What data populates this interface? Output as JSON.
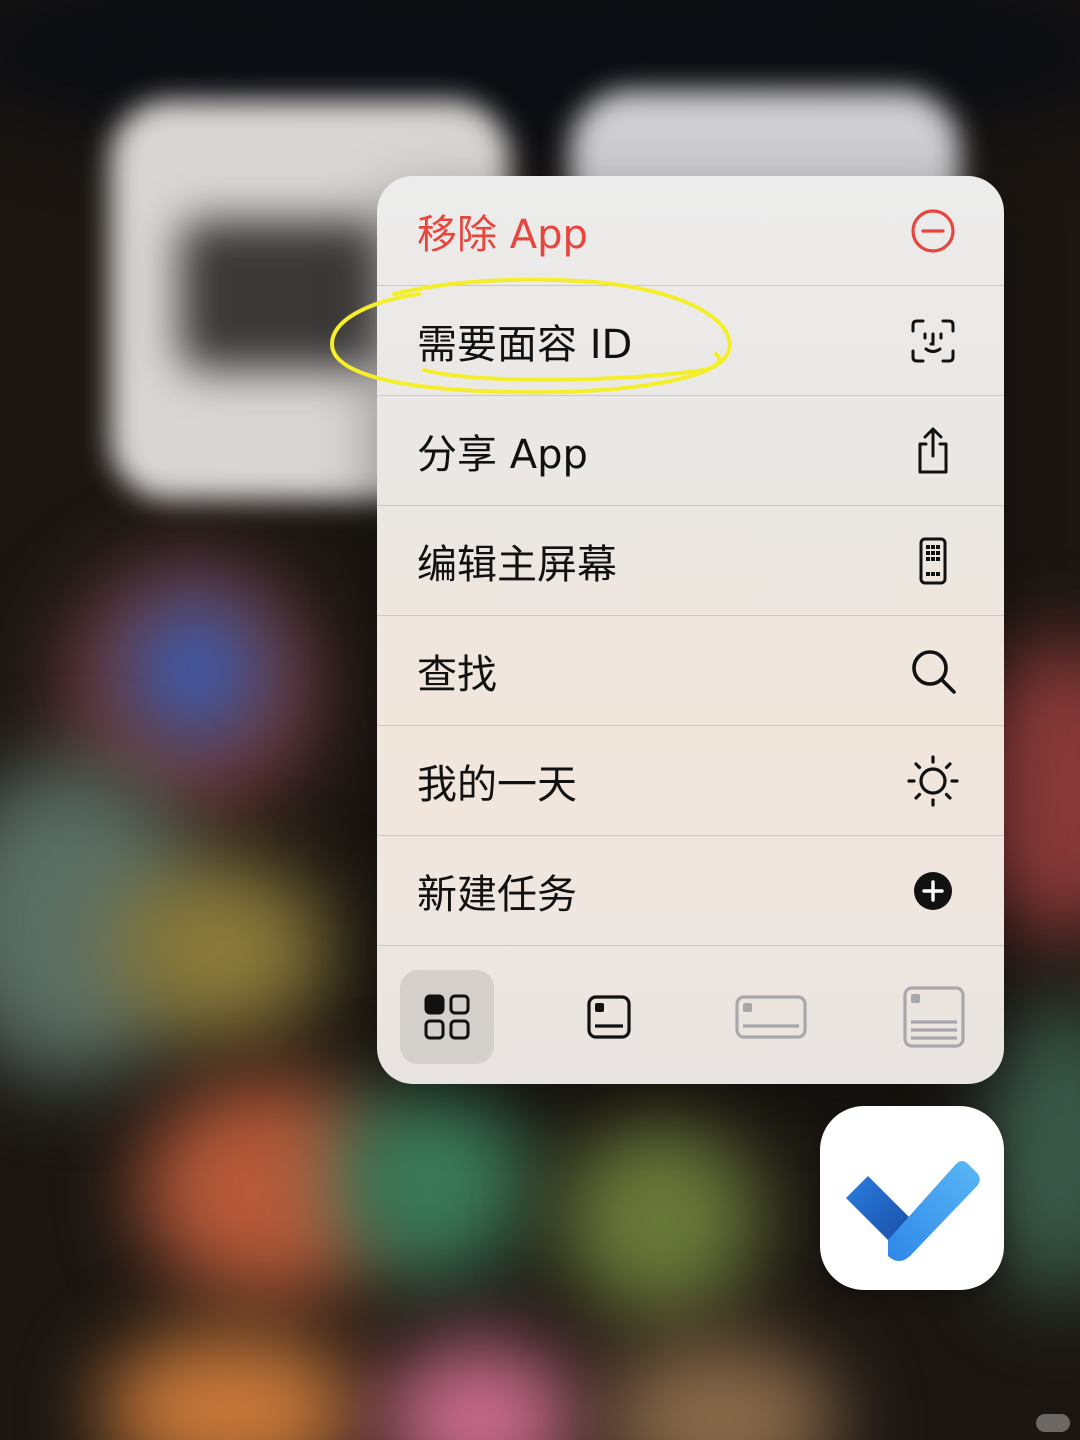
{
  "menu": {
    "items": [
      {
        "label": "移除 App",
        "icon": "minus-circle-icon",
        "destructive": true
      },
      {
        "label": "需要面容 ID",
        "icon": "face-id-icon"
      },
      {
        "label": "分享 App",
        "icon": "share-icon"
      },
      {
        "label": "编辑主屏幕",
        "icon": "phone-grid-icon"
      },
      {
        "label": "查找",
        "icon": "magnifier-icon"
      },
      {
        "label": "我的一天",
        "icon": "sun-icon"
      },
      {
        "label": "新建任务",
        "icon": "plus-circle-filled-icon"
      }
    ],
    "widget_sizes": [
      {
        "icon": "app-grid-icon",
        "selected": true
      },
      {
        "icon": "small-widget-icon",
        "selected": false
      },
      {
        "icon": "medium-widget-icon",
        "selected": false
      },
      {
        "icon": "large-widget-icon",
        "selected": false
      }
    ]
  },
  "colors": {
    "destructive": "#e8453c",
    "highlight": "#f5ee2a",
    "check_dark": "#1f5fbf",
    "check_light": "#3da0f0"
  },
  "app": {
    "icon": "checkmark-todo-icon"
  }
}
